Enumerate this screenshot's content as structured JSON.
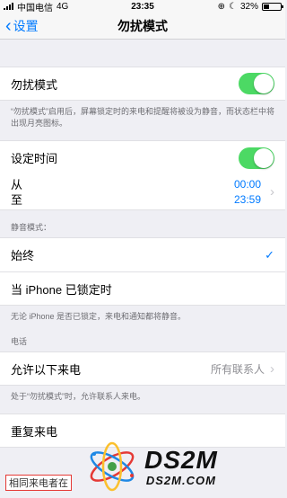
{
  "status": {
    "carrier": "中国电信",
    "network": "4G",
    "time": "23:35",
    "battery": "32%",
    "battery_level": 0.32
  },
  "nav": {
    "back_label": "设置",
    "title": "勿扰模式"
  },
  "dnd": {
    "label": "勿扰模式",
    "enabled": true,
    "footer": "“勿扰模式”启用后，屏幕锁定时的来电和提醒将被设为静音，而状态栏中将出现月亮图标。"
  },
  "schedule": {
    "label": "设定时间",
    "enabled": true,
    "from_label": "从",
    "to_label": "至",
    "from_time": "00:00",
    "to_time": "23:59"
  },
  "silence": {
    "header": "静音模式：",
    "options": [
      {
        "label": "始终",
        "selected": true
      },
      {
        "label": "当 iPhone 已锁定时",
        "selected": false
      }
    ],
    "footer": "无论 iPhone 是否已锁定，来电和通知都将静音。"
  },
  "phone": {
    "header": "电话",
    "allow_label": "允许以下来电",
    "allow_value": "所有联系人",
    "allow_footer": "处于“勿扰模式”时，允许联系人来电。",
    "repeat_label": "重复来电",
    "repeat_footer_partial": "相同来电者在"
  },
  "watermark": {
    "big": "DS2M",
    "small": "DS2M.COM"
  }
}
